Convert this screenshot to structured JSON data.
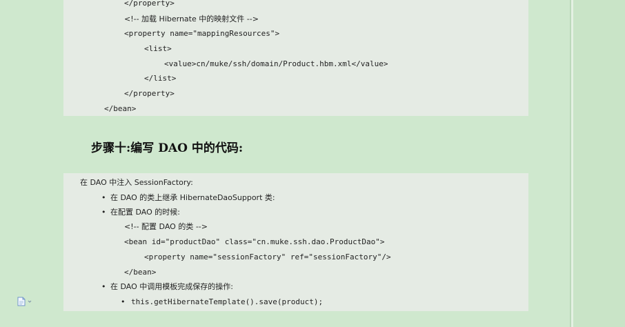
{
  "code_block_1": {
    "lines": [
      "</property>",
      "<!-- 加载 Hibernate 中的映射文件 -->",
      "<property name=\"mappingResources\">",
      "<list>",
      "<value>cn/muke/ssh/domain/Product.hbm.xml</value>",
      "</list>",
      "</property>",
      "</bean>"
    ]
  },
  "heading": "步骤十:编写 DAO 中的代码:",
  "code_block_2": {
    "intro": "在 DAO 中注入 SessionFactory:",
    "bullet_1": "在 DAO 的类上继承 HibernateDaoSupport 类:",
    "bullet_2": "在配置 DAO 的时候:",
    "comment": "<!-- 配置 DAO 的类 -->",
    "bean_open": "<bean id=\"productDao\" class=\"cn.muke.ssh.dao.ProductDao\">",
    "property_line": "<property name=\"sessionFactory\" ref=\"sessionFactory\"/>",
    "bean_close": "</bean>",
    "bullet_3": "在 DAO 中调用模板完成保存的操作:",
    "bullet_4": "this.getHibernateTemplate().save(product);"
  },
  "icons": {
    "doc": "document-icon"
  },
  "colors": {
    "background": "#cfe8ce",
    "code_bg": "#e5ebe4",
    "spellcheck": "#e03030"
  }
}
